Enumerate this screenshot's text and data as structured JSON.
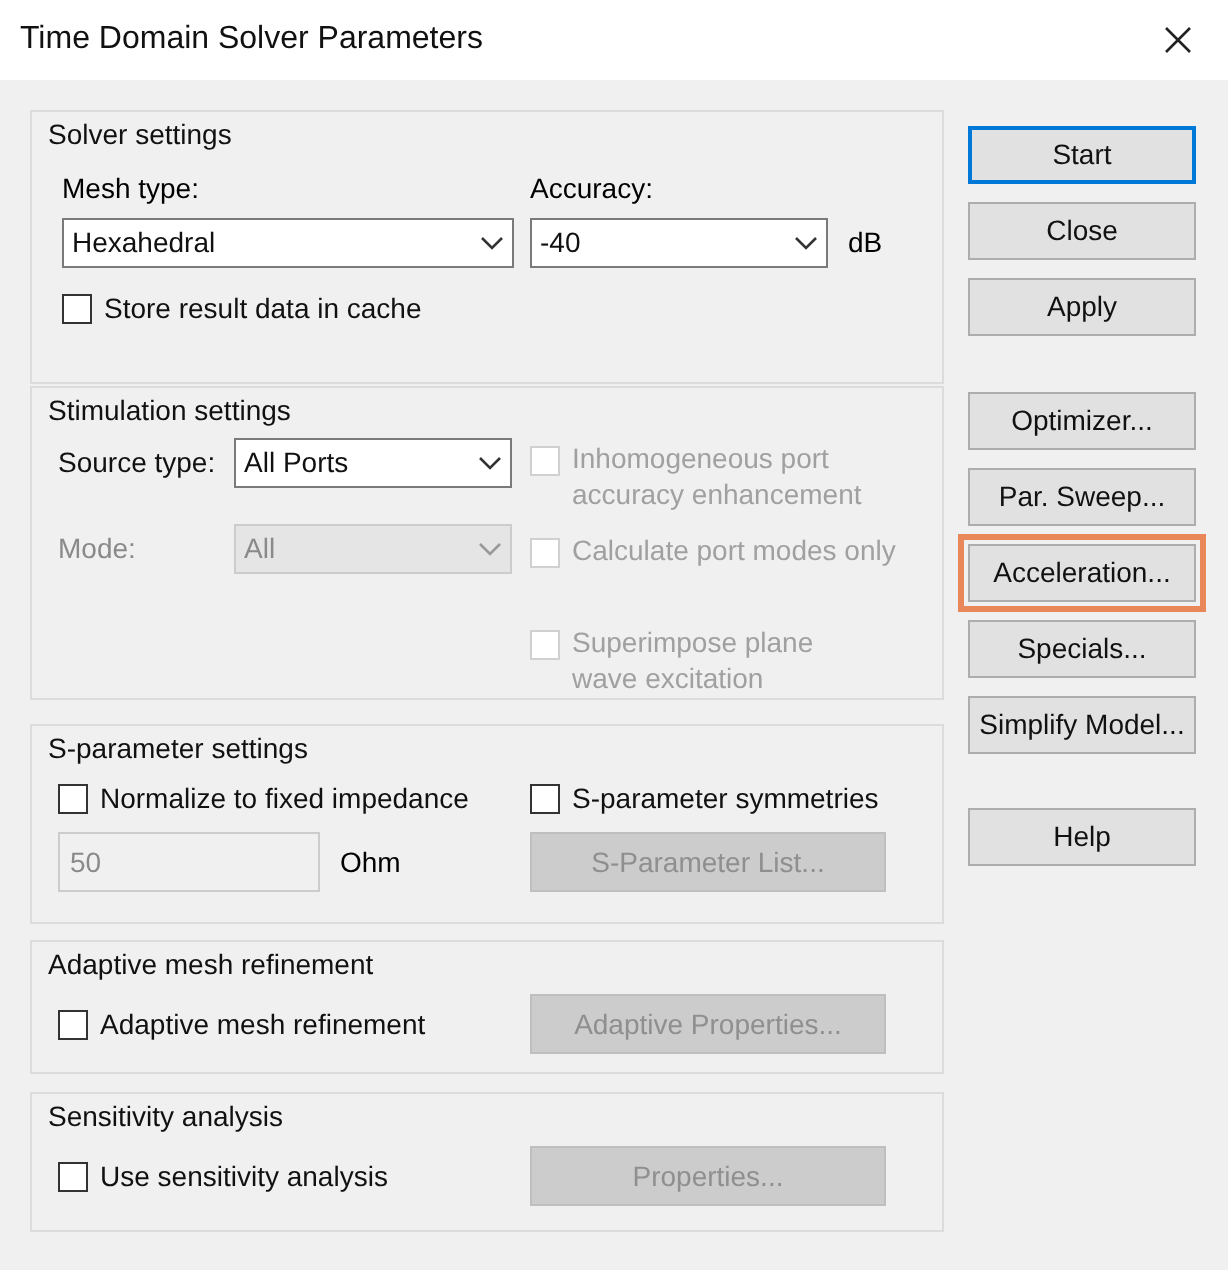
{
  "window": {
    "title": "Time Domain Solver Parameters"
  },
  "solver_settings": {
    "title": "Solver settings",
    "mesh_type": {
      "label": "Mesh type:",
      "value": "Hexahedral"
    },
    "accuracy": {
      "label": "Accuracy:",
      "value": "-40",
      "unit": "dB"
    },
    "cache": {
      "label": "Store result data in cache",
      "checked": false
    }
  },
  "stimulation_settings": {
    "title": "Stimulation settings",
    "source_type": {
      "label": "Source type:",
      "value": "All Ports",
      "disabled": false
    },
    "mode": {
      "label": "Mode:",
      "value": "All",
      "disabled": true
    },
    "options": [
      {
        "lines": [
          "Inhomogeneous port",
          "accuracy enhancement"
        ],
        "checked": false,
        "disabled": true
      },
      {
        "lines": [
          "Calculate port modes only"
        ],
        "checked": false,
        "disabled": true
      },
      {
        "lines": [
          "Superimpose plane",
          "wave excitation"
        ],
        "checked": false,
        "disabled": true
      }
    ]
  },
  "s_parameter_settings": {
    "title": "S-parameter settings",
    "normalize": {
      "label": "Normalize to fixed impedance",
      "checked": false
    },
    "symmetries": {
      "label": "S-parameter symmetries",
      "checked": false
    },
    "impedance": {
      "value": "50",
      "unit": "Ohm",
      "disabled": true
    },
    "list_button": {
      "label": "S-Parameter List...",
      "disabled": true
    }
  },
  "adaptive_mesh_refinement": {
    "title": "Adaptive mesh refinement",
    "checkbox": {
      "label": "Adaptive mesh refinement",
      "checked": false
    },
    "button": {
      "label": "Adaptive Properties...",
      "disabled": true
    }
  },
  "sensitivity_analysis": {
    "title": "Sensitivity analysis",
    "checkbox": {
      "label": "Use sensitivity analysis",
      "checked": false
    },
    "button": {
      "label": "Properties...",
      "disabled": true
    }
  },
  "button_groups": [
    [
      {
        "label": "Start",
        "focused": true,
        "highlighted": false
      },
      {
        "label": "Close",
        "focused": false,
        "highlighted": false
      },
      {
        "label": "Apply",
        "focused": false,
        "highlighted": false
      }
    ],
    [
      {
        "label": "Optimizer...",
        "focused": false,
        "highlighted": false
      },
      {
        "label": "Par. Sweep...",
        "focused": false,
        "highlighted": false
      },
      {
        "label": "Acceleration...",
        "focused": false,
        "highlighted": true
      },
      {
        "label": "Specials...",
        "focused": false,
        "highlighted": false
      },
      {
        "label": "Simplify Model...",
        "focused": false,
        "highlighted": false
      }
    ],
    [
      {
        "label": "Help",
        "focused": false,
        "highlighted": false
      }
    ]
  ]
}
